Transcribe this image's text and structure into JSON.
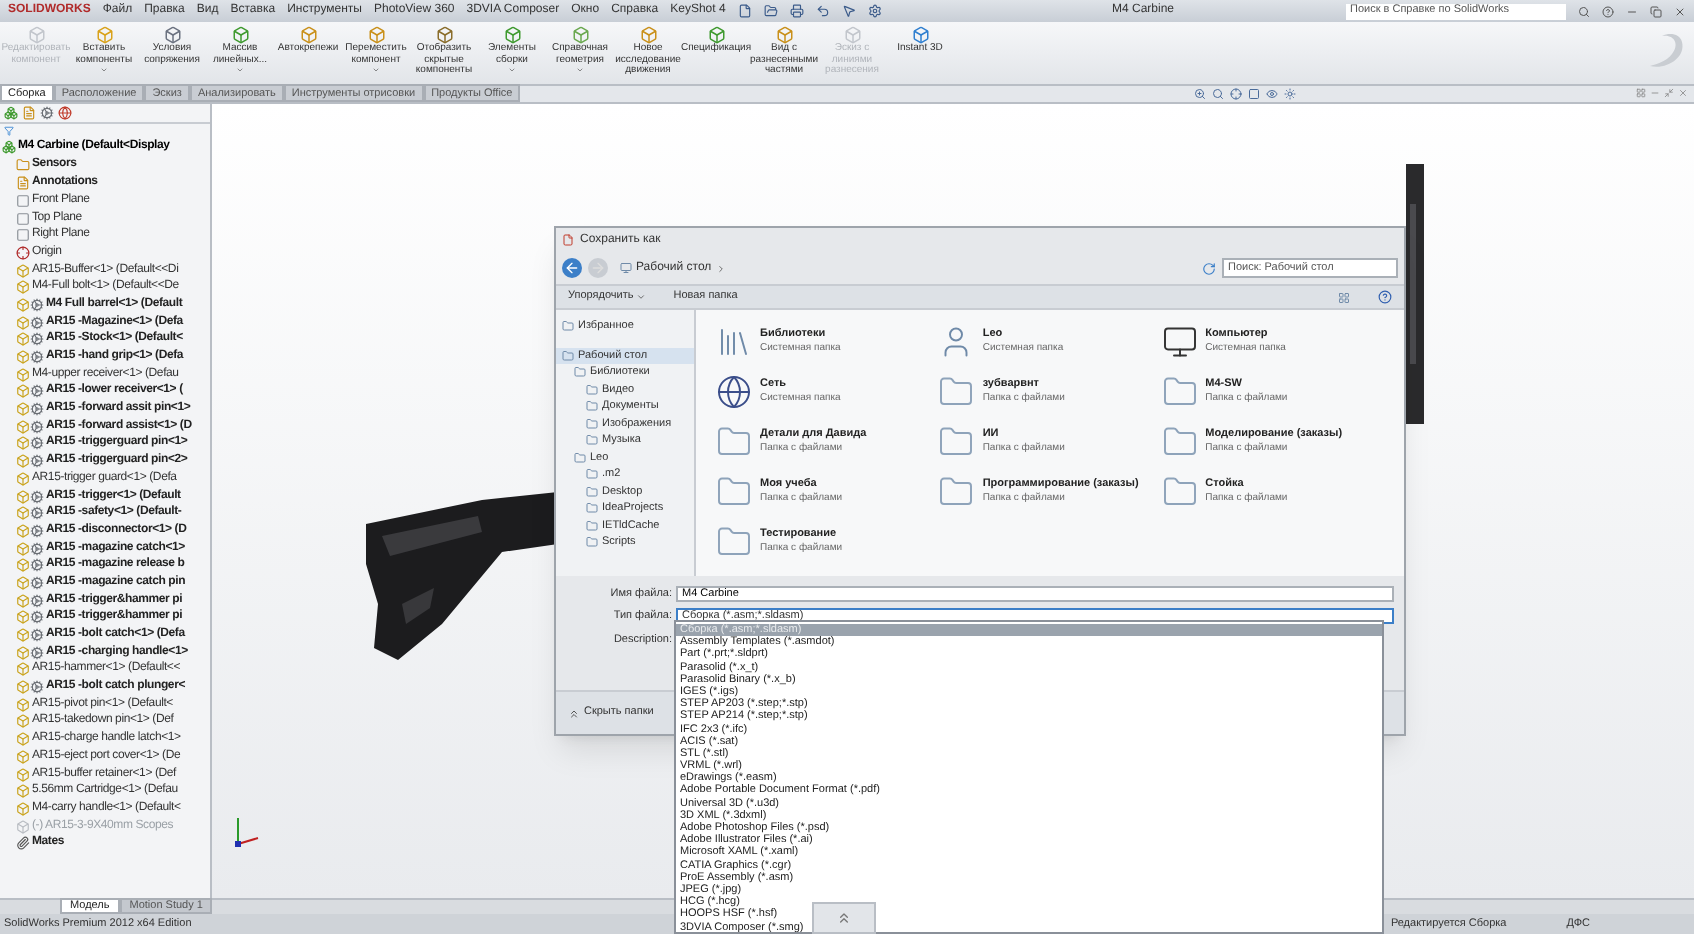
{
  "app": {
    "logo": "SOLIDWORKS",
    "menu": [
      "Файл",
      "Правка",
      "Вид",
      "Вставка",
      "Инструменты",
      "PhotoView 360",
      "3DVIA Composer",
      "Окно",
      "Справка",
      "KeyShot 4"
    ],
    "document_title": "M4 Carbine",
    "help_search": {
      "placeholder": "Поиск в Справке по SolidWorks"
    }
  },
  "ribbon": [
    {
      "label": "Редактировать компонент",
      "disabled": true,
      "has_menu": false
    },
    {
      "label": "Вставить компоненты",
      "disabled": false,
      "has_menu": true
    },
    {
      "label": "Условия сопряжения",
      "disabled": false,
      "has_menu": false
    },
    {
      "label": "Массив линейных...",
      "disabled": false,
      "has_menu": true
    },
    {
      "label": "Автокрепежи",
      "disabled": false,
      "has_menu": false
    },
    {
      "label": "Переместить компонент",
      "disabled": false,
      "has_menu": true
    },
    {
      "label": "Отобразить скрытые компоненты",
      "disabled": false,
      "has_menu": false
    },
    {
      "label": "Элементы сборки",
      "disabled": false,
      "has_menu": true
    },
    {
      "label": "Справочная геометрия",
      "disabled": false,
      "has_menu": true
    },
    {
      "label": "Новое исследование движения",
      "disabled": false,
      "has_menu": false
    },
    {
      "label": "Спецификация",
      "disabled": false,
      "has_menu": false
    },
    {
      "label": "Вид с разнесенными частями",
      "disabled": false,
      "has_menu": false
    },
    {
      "label": "Эскиз с линиями разнесения",
      "disabled": true,
      "has_menu": false
    },
    {
      "label": "Instant 3D",
      "disabled": false,
      "has_menu": false
    }
  ],
  "command_tabs": [
    {
      "label": "Сборка",
      "selected": true
    },
    {
      "label": "Расположение",
      "selected": false
    },
    {
      "label": "Эскиз",
      "selected": false
    },
    {
      "label": "Анализировать",
      "selected": false
    },
    {
      "label": "Инструменты отрисовки",
      "selected": false
    },
    {
      "label": "Продукты Office",
      "selected": false
    }
  ],
  "feature_tree": {
    "root": {
      "label": "M4 Carbine (Default<Display",
      "children": [
        {
          "label": "Sensors",
          "kind": "sensors"
        },
        {
          "label": "Annotations",
          "kind": "annotations"
        },
        {
          "label": "Front Plane",
          "kind": "plane"
        },
        {
          "label": "Top Plane",
          "kind": "plane"
        },
        {
          "label": "Right Plane",
          "kind": "plane"
        },
        {
          "label": "Origin",
          "kind": "origin"
        },
        {
          "label": "AR15-Buffer<1> (Default<<Di",
          "kind": "part"
        },
        {
          "label": "M4-Full bolt<1> (Default<<De",
          "kind": "part"
        },
        {
          "label": "M4 Full barrel<1> (Default",
          "kind": "assembly"
        },
        {
          "label": "AR15 -Magazine<1> (Defa",
          "kind": "assembly"
        },
        {
          "label": "AR15 -Stock<1> (Default<",
          "kind": "assembly"
        },
        {
          "label": "AR15 -hand grip<1> (Defa",
          "kind": "assembly"
        },
        {
          "label": "M4-upper receiver<1> (Defau",
          "kind": "part"
        },
        {
          "label": "AR15 -lower receiver<1> (",
          "kind": "assembly"
        },
        {
          "label": "AR15 -forward assit pin<1>",
          "kind": "assembly"
        },
        {
          "label": "AR15 -forward assist<1> (D",
          "kind": "assembly"
        },
        {
          "label": "AR15 -triggerguard pin<1>",
          "kind": "assembly"
        },
        {
          "label": "AR15 -triggerguard pin<2>",
          "kind": "assembly"
        },
        {
          "label": "AR15-trigger guard<1> (Defa",
          "kind": "part"
        },
        {
          "label": "AR15 -trigger<1> (Default",
          "kind": "assembly"
        },
        {
          "label": "AR15 -safety<1> (Default-",
          "kind": "assembly"
        },
        {
          "label": "AR15 -disconnector<1> (D",
          "kind": "assembly"
        },
        {
          "label": "AR15 -magazine catch<1>",
          "kind": "assembly"
        },
        {
          "label": "AR15 -magazine release b",
          "kind": "assembly"
        },
        {
          "label": "AR15 -magazine catch pin",
          "kind": "assembly"
        },
        {
          "label": "AR15 -trigger&hammer pi",
          "kind": "assembly"
        },
        {
          "label": "AR15 -trigger&hammer pi",
          "kind": "assembly"
        },
        {
          "label": "AR15 -bolt catch<1> (Defa",
          "kind": "assembly"
        },
        {
          "label": "AR15 -charging handle<1>",
          "kind": "assembly"
        },
        {
          "label": "AR15-hammer<1> (Default<<",
          "kind": "part"
        },
        {
          "label": "AR15 -bolt catch plunger<",
          "kind": "assembly"
        },
        {
          "label": "AR15-pivot pin<1> (Default<",
          "kind": "part"
        },
        {
          "label": "AR15-takedown pin<1> (Def",
          "kind": "part"
        },
        {
          "label": "AR15-charge handle latch<1>",
          "kind": "part"
        },
        {
          "label": "AR15-eject port cover<1> (De",
          "kind": "part"
        },
        {
          "label": "AR15-buffer retainer<1> (Def",
          "kind": "part"
        },
        {
          "label": "5.56mm Cartridge<1> (Defau",
          "kind": "part"
        },
        {
          "label": "M4-carry handle<1> (Default<",
          "kind": "part"
        },
        {
          "label": "(-) AR15-3-9X40mm Scopes",
          "kind": "suppressed"
        },
        {
          "label": "Mates",
          "kind": "mates"
        }
      ]
    }
  },
  "save_dialog": {
    "title": "Сохранить как",
    "breadcrumb": "Рабочий стол",
    "search": {
      "placeholder": "Поиск: Рабочий стол"
    },
    "organize": "Упорядочить",
    "new_folder": "Новая папка",
    "nav_tree": [
      {
        "label": "Избранное",
        "selected": false
      },
      {
        "label": "Рабочий стол",
        "selected": true,
        "children": [
          {
            "label": "Библиотеки",
            "selected": false,
            "children": [
              {
                "label": "Видео",
                "selected": false
              },
              {
                "label": "Документы",
                "selected": false
              },
              {
                "label": "Изображения",
                "selected": false
              },
              {
                "label": "Музыка",
                "selected": false
              }
            ]
          },
          {
            "label": "Leo",
            "selected": false,
            "children": [
              {
                "label": ".m2",
                "selected": false
              },
              {
                "label": "Desktop",
                "selected": false
              },
              {
                "label": "IdeaProjects",
                "selected": false
              },
              {
                "label": "IETldCache",
                "selected": false
              },
              {
                "label": "Scripts",
                "selected": false
              }
            ]
          }
        ]
      }
    ],
    "items": [
      {
        "name": "Библиотеки",
        "type": "Системная папка",
        "kind": "library"
      },
      {
        "name": "Leo",
        "type": "Системная папка",
        "kind": "user"
      },
      {
        "name": "Компьютер",
        "type": "Системная папка",
        "kind": "computer"
      },
      {
        "name": "Сеть",
        "type": "Системная папка",
        "kind": "network"
      },
      {
        "name": "зубварвнт",
        "type": "Папка с файлами",
        "kind": "folder"
      },
      {
        "name": "M4-SW",
        "type": "Папка с файлами",
        "kind": "folder"
      },
      {
        "name": "Детали для Давида",
        "type": "Папка с файлами",
        "kind": "folder"
      },
      {
        "name": "ИИ",
        "type": "Папка с файлами",
        "kind": "folder"
      },
      {
        "name": "Моделирование (заказы)",
        "type": "Папка с файлами",
        "kind": "folder"
      },
      {
        "name": "Моя учеба",
        "type": "Папка с файлами",
        "kind": "folder"
      },
      {
        "name": "Программирование (заказы)",
        "type": "Папка с файлами",
        "kind": "folder"
      },
      {
        "name": "Стойка",
        "type": "Папка с файлами",
        "kind": "folder"
      },
      {
        "name": "Тестирование",
        "type": "Папка с файлами",
        "kind": "folder"
      }
    ],
    "file_name": {
      "label": "Имя файла:",
      "value": "M4 Carbine"
    },
    "file_type": {
      "label": "Тип файла:",
      "value": "Сборка (*.asm;*.sldasm)",
      "expanded": true,
      "options": [
        {
          "label": "Сборка (*.asm;*.sldasm)",
          "selected": true
        },
        {
          "label": "Assembly Templates (*.asmdot)",
          "selected": false
        },
        {
          "label": "Part (*.prt;*.sldprt)",
          "selected": false
        },
        {
          "label": "Parasolid (*.x_t)",
          "selected": false
        },
        {
          "label": "Parasolid Binary (*.x_b)",
          "selected": false
        },
        {
          "label": "IGES (*.igs)",
          "selected": false
        },
        {
          "label": "STEP AP203 (*.step;*.stp)",
          "selected": false
        },
        {
          "label": "STEP AP214 (*.step;*.stp)",
          "selected": false
        },
        {
          "label": "IFC 2x3 (*.ifc)",
          "selected": false
        },
        {
          "label": "ACIS (*.sat)",
          "selected": false
        },
        {
          "label": "STL (*.stl)",
          "selected": false
        },
        {
          "label": "VRML (*.wrl)",
          "selected": false
        },
        {
          "label": "eDrawings (*.easm)",
          "selected": false
        },
        {
          "label": "Adobe Portable Document Format (*.pdf)",
          "selected": false
        },
        {
          "label": "Universal 3D (*.u3d)",
          "selected": false
        },
        {
          "label": "3D XML (*.3dxml)",
          "selected": false
        },
        {
          "label": "Adobe Photoshop Files (*.psd)",
          "selected": false
        },
        {
          "label": "Adobe Illustrator Files (*.ai)",
          "selected": false
        },
        {
          "label": "Microsoft XAML (*.xaml)",
          "selected": false
        },
        {
          "label": "CATIA Graphics (*.cgr)",
          "selected": false
        },
        {
          "label": "ProE Assembly (*.asm)",
          "selected": false
        },
        {
          "label": "JPEG (*.jpg)",
          "selected": false
        },
        {
          "label": "HCG (*.hcg)",
          "selected": false
        },
        {
          "label": "HOOPS HSF (*.hsf)",
          "selected": false
        },
        {
          "label": "3DVIA Composer (*.smg)",
          "selected": false
        }
      ]
    },
    "description": {
      "label": "Description:"
    },
    "hide_folders": "Скрыть папки"
  },
  "model_tabs": [
    {
      "label": "Модель",
      "selected": true
    },
    {
      "label": "Motion Study 1",
      "selected": false
    }
  ],
  "status_bar": {
    "edition": "SolidWorks Premium 2012 x64 Edition",
    "mode": "Редактируется Сборка",
    "units": "ДФС"
  }
}
